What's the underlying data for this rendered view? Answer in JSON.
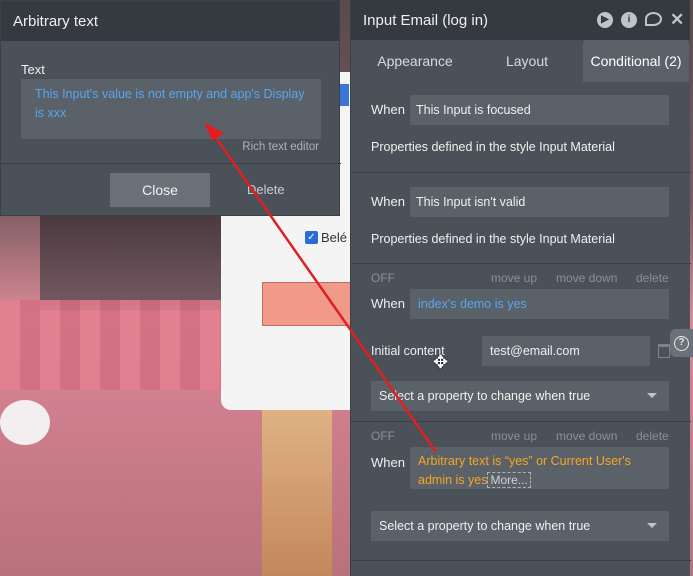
{
  "popup": {
    "title": "Arbitrary text",
    "field_label": "Text",
    "text_value": "This Input's value is not empty and app's Display is xxx",
    "rich_text_editor": "Rich text editor",
    "close_label": "Close",
    "delete_label": "Delete"
  },
  "background_page": {
    "checkbox_label": "Belé"
  },
  "editor": {
    "title": "Input Email (log in)",
    "tabs": [
      "Appearance",
      "Layout",
      "Conditional (2)"
    ],
    "conditions": [
      {
        "when_label": "When",
        "expression": "This Input is focused",
        "properties": "Properties defined in the style Input Material"
      },
      {
        "when_label": "When",
        "expression": "This Input isn't valid",
        "properties": "Properties defined in the style Input Material"
      },
      {
        "status": "OFF",
        "move_up": "move up",
        "move_down": "move down",
        "delete": "delete",
        "when_label": "When",
        "expression": "index's demo is yes",
        "property_label": "Initial content",
        "property_value": "test@email.com",
        "select_placeholder": "Select a property to change when true"
      },
      {
        "status": "OFF",
        "move_up": "move up",
        "move_down": "move down",
        "delete": "delete",
        "when_label": "When",
        "expression_part1": "Arbitrary text  is  “yes”  or  Current User's",
        "expression_part2": "admin  is yes",
        "more_label": "More...",
        "select_placeholder": "Select a property to change when true"
      }
    ]
  },
  "colors": {
    "panel_bg": "#4a5158",
    "header_bg": "#343a40",
    "link_blue": "#58a6f0",
    "expression_orange": "#f5a623",
    "arrow_red": "#e02020"
  }
}
